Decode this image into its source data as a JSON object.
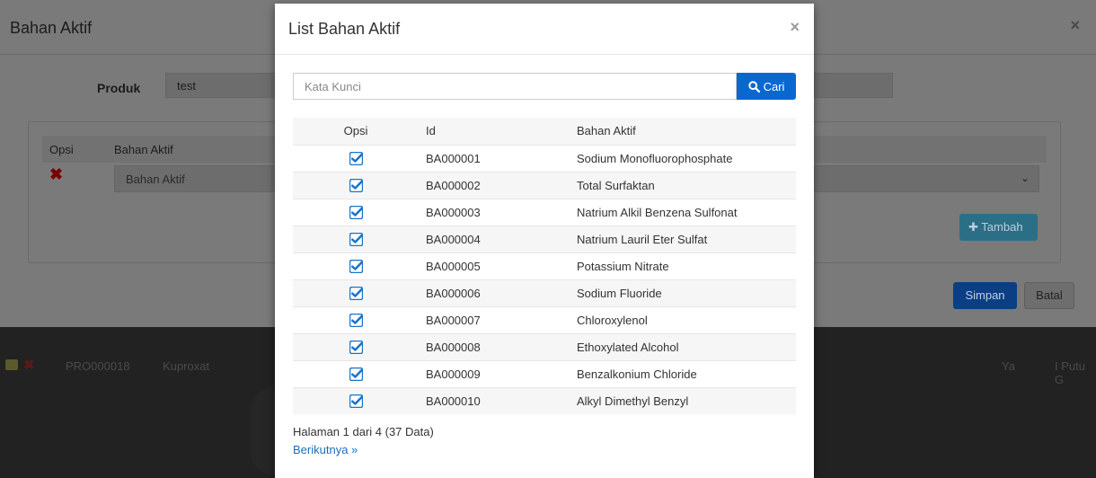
{
  "background_row": {
    "id": "PRO000018",
    "name": "Kuproxat",
    "status": "Ya",
    "user": "I Putu G"
  },
  "back_modal": {
    "title": "Bahan Aktif",
    "close": "×",
    "produk_label": "Produk",
    "produk_value": "test",
    "table_headers": {
      "opsi": "Opsi",
      "bahan_aktif": "Bahan Aktif"
    },
    "select_placeholder": "Bahan Aktif",
    "tambah_label": "Tambah",
    "simpan_label": "Simpan",
    "batal_label": "Batal"
  },
  "modal": {
    "title": "List Bahan Aktif",
    "close": "×",
    "search": {
      "placeholder": "Kata Kunci",
      "value": "",
      "button_label": "Cari"
    },
    "headers": {
      "opsi": "Opsi",
      "id": "Id",
      "bahan_aktif": "Bahan Aktif"
    },
    "rows": [
      {
        "id": "BA000001",
        "name": "Sodium Monofluorophosphate",
        "checked": true
      },
      {
        "id": "BA000002",
        "name": "Total Surfaktan",
        "checked": true
      },
      {
        "id": "BA000003",
        "name": "Natrium Alkil Benzena Sulfonat",
        "checked": true
      },
      {
        "id": "BA000004",
        "name": "Natrium Lauril Eter Sulfat",
        "checked": true
      },
      {
        "id": "BA000005",
        "name": "Potassium Nitrate",
        "checked": true
      },
      {
        "id": "BA000006",
        "name": "Sodium Fluoride",
        "checked": true
      },
      {
        "id": "BA000007",
        "name": "Chloroxylenol",
        "checked": true
      },
      {
        "id": "BA000008",
        "name": "Ethoxylated Alcohol",
        "checked": true
      },
      {
        "id": "BA000009",
        "name": "Benzalkonium Chloride",
        "checked": true
      },
      {
        "id": "BA000010",
        "name": "Alkyl Dimethyl Benzyl",
        "checked": true
      }
    ],
    "pagination_text": "Halaman 1 dari 4 (37 Data)",
    "next_link": "Berikutnya »"
  },
  "colors": {
    "primary": "#0868d0",
    "link": "#1a6fb8",
    "checkbox": "#1a73c8"
  }
}
